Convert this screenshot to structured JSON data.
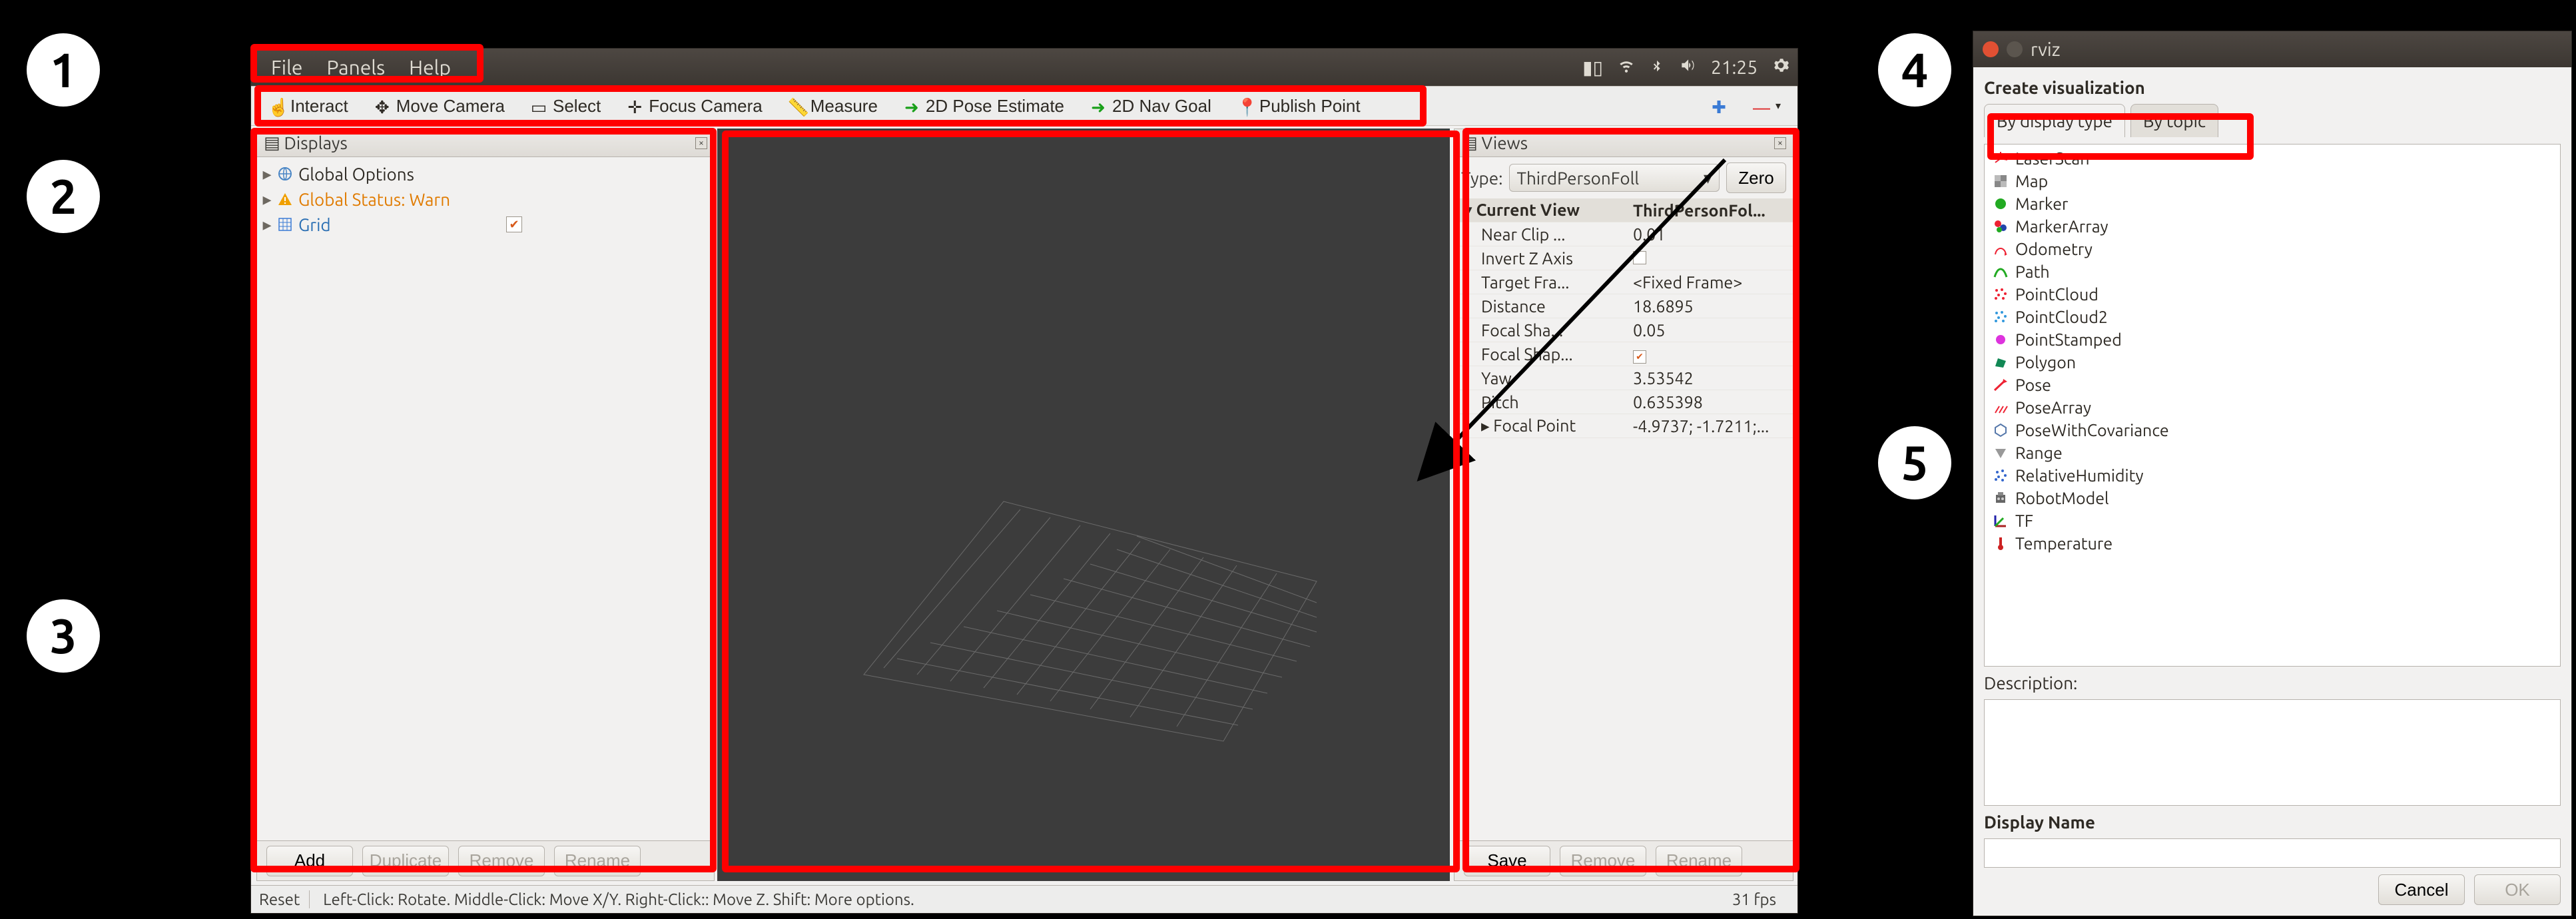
{
  "menubar": {
    "file": "File",
    "panels": "Panels",
    "help": "Help",
    "clock": "21:25"
  },
  "toolbar": {
    "interact": "Interact",
    "moveCamera": "Move Camera",
    "select": "Select",
    "focusCamera": "Focus Camera",
    "measure": "Measure",
    "poseEstimate": "2D Pose Estimate",
    "navGoal": "2D Nav Goal",
    "publishPoint": "Publish Point"
  },
  "displays": {
    "title": "Displays",
    "items": [
      {
        "icon": "globe",
        "label": "Global Options",
        "link": false
      },
      {
        "icon": "warn",
        "label": "Global Status: Warn",
        "link": false,
        "color": "#e07b00"
      },
      {
        "icon": "grid",
        "label": "Grid",
        "link": true,
        "checked": true
      }
    ],
    "buttons": {
      "add": "Add",
      "duplicate": "Duplicate",
      "remove": "Remove",
      "rename": "Rename"
    }
  },
  "viewsPanel": {
    "title": "Views",
    "typeLabel": "Type:",
    "typeValue": "ThirdPersonFoll",
    "zero": "Zero",
    "currentView": {
      "k": "Current View",
      "v": "ThirdPersonFol..."
    },
    "rows": [
      {
        "k": "Near Clip ...",
        "v": "0.01"
      },
      {
        "k": "Invert Z Axis",
        "v_check": false
      },
      {
        "k": "Target Fra...",
        "v": "<Fixed Frame>"
      },
      {
        "k": "Distance",
        "v": "18.6895"
      },
      {
        "k": "Focal Sha...",
        "v": "0.05"
      },
      {
        "k": "Focal Shap...",
        "v_check": true
      },
      {
        "k": "Yaw",
        "v": "3.53542"
      },
      {
        "k": "Pitch",
        "v": "0.635398"
      },
      {
        "k": "Focal Point",
        "v": "-4.9737; -1.7211;..."
      }
    ],
    "buttons": {
      "save": "Save",
      "remove": "Remove",
      "rename": "Rename"
    }
  },
  "statusbar": {
    "reset": "Reset",
    "hint": "Left-Click: Rotate. Middle-Click: Move X/Y. Right-Click:: Move Z. Shift: More options.",
    "fps": "31 fps"
  },
  "dialog": {
    "winTitle": "rviz",
    "heading": "Create visualization",
    "tab1": "By display type",
    "tab2": "By topic",
    "items": [
      {
        "icon": "laser",
        "label": "LaserScan"
      },
      {
        "icon": "map",
        "label": "Map"
      },
      {
        "icon": "marker",
        "label": "Marker"
      },
      {
        "icon": "markers",
        "label": "MarkerArray"
      },
      {
        "icon": "odom",
        "label": "Odometry"
      },
      {
        "icon": "path",
        "label": "Path"
      },
      {
        "icon": "pcloud",
        "label": "PointCloud"
      },
      {
        "icon": "pcloud2",
        "label": "PointCloud2"
      },
      {
        "icon": "pstamp",
        "label": "PointStamped"
      },
      {
        "icon": "poly",
        "label": "Polygon"
      },
      {
        "icon": "pose",
        "label": "Pose"
      },
      {
        "icon": "poses",
        "label": "PoseArray"
      },
      {
        "icon": "posecov",
        "label": "PoseWithCovariance"
      },
      {
        "icon": "range",
        "label": "Range"
      },
      {
        "icon": "humid",
        "label": "RelativeHumidity"
      },
      {
        "icon": "robot",
        "label": "RobotModel"
      },
      {
        "icon": "tf",
        "label": "TF"
      },
      {
        "icon": "temp",
        "label": "Temperature"
      }
    ],
    "descLabel": "Description:",
    "dispNameLabel": "Display Name",
    "cancel": "Cancel",
    "ok": "OK"
  },
  "callouts": {
    "c1": "1",
    "c2": "2",
    "c3": "3",
    "c4": "4",
    "c5": "5"
  }
}
